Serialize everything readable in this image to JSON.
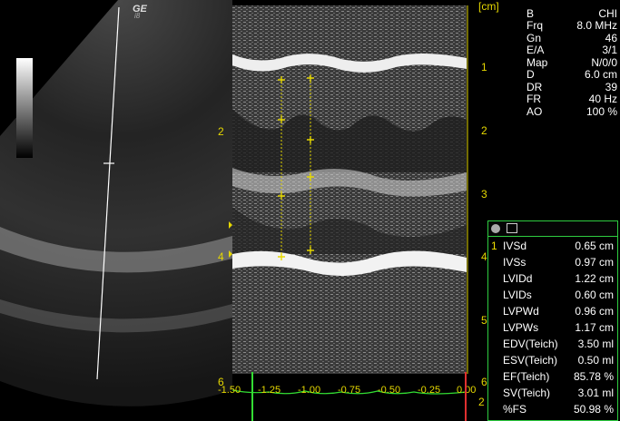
{
  "header": {
    "logo": "GE",
    "probe": "i8"
  },
  "depth_scale": {
    "unit": "[cm]",
    "right_ticks": [
      "1",
      "2",
      "3",
      "4",
      "5",
      "6"
    ],
    "left_ticks": [
      "2",
      "4",
      "6"
    ]
  },
  "time_axis": {
    "ticks": [
      "-1.50",
      "-1.25",
      "-1.00",
      "-0.75",
      "-0.50",
      "-0.25",
      "0.00"
    ],
    "suffix": "2"
  },
  "params": [
    {
      "label": "B",
      "value": "CHI"
    },
    {
      "label": "Frq",
      "value": "8.0 MHz"
    },
    {
      "label": "Gn",
      "value": "46"
    },
    {
      "label": "E/A",
      "value": "3/1"
    },
    {
      "label": "Map",
      "value": "N/0/0"
    },
    {
      "label": "D",
      "value": "6.0 cm"
    },
    {
      "label": "DR",
      "value": "39"
    },
    {
      "label": "FR",
      "value": "40 Hz"
    },
    {
      "label": "AO",
      "value": "100 %"
    }
  ],
  "measurements": {
    "index": "1",
    "rows": [
      {
        "label": "IVSd",
        "value": "0.65 cm"
      },
      {
        "label": "IVSs",
        "value": "0.97 cm"
      },
      {
        "label": "LVIDd",
        "value": "1.22 cm"
      },
      {
        "label": "LVIDs",
        "value": "0.60 cm"
      },
      {
        "label": "LVPWd",
        "value": "0.96 cm"
      },
      {
        "label": "LVPWs",
        "value": "1.17 cm"
      },
      {
        "label": "EDV(Teich)",
        "value": "3.50 ml"
      },
      {
        "label": "ESV(Teich)",
        "value": "0.50 ml"
      },
      {
        "label": "EF(Teich)",
        "value": "85.78 %"
      },
      {
        "label": "SV(Teich)",
        "value": "3.01 ml"
      },
      {
        "label": "%FS",
        "value": "50.98 %"
      }
    ]
  },
  "colors": {
    "accent": "#2ecc40",
    "caliper": "#e6d800",
    "ecg": "#33dd33",
    "cursor": "#ffffff"
  }
}
